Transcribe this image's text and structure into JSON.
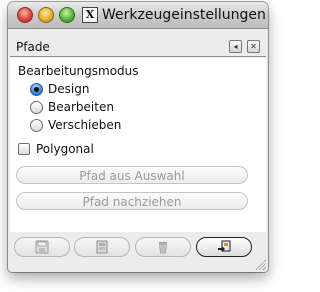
{
  "window": {
    "title": "Werkzeugeinstellungen",
    "x11_glyph": "X"
  },
  "panel": {
    "title": "Pfade",
    "back_glyph": "◂",
    "close_glyph": "✕"
  },
  "mode": {
    "label": "Bearbeitungsmodus",
    "options": [
      {
        "label": "Design",
        "selected": true
      },
      {
        "label": "Bearbeiten",
        "selected": false
      },
      {
        "label": "Verschieben",
        "selected": false
      }
    ]
  },
  "polygonal": {
    "label": "Polygonal",
    "checked": false
  },
  "actions": {
    "from_selection": "Pfad aus Auswahl",
    "stroke_path": "Pfad nachziehen"
  },
  "toolbar": {
    "buttons": [
      {
        "icon": "save-icon",
        "enabled": false
      },
      {
        "icon": "restore-icon",
        "enabled": false
      },
      {
        "icon": "trash-icon",
        "enabled": false
      },
      {
        "icon": "reset-icon",
        "enabled": true
      }
    ]
  },
  "colors": {
    "radio_selected": "#3b82e0",
    "disabled_text": "#9a9a9a"
  }
}
